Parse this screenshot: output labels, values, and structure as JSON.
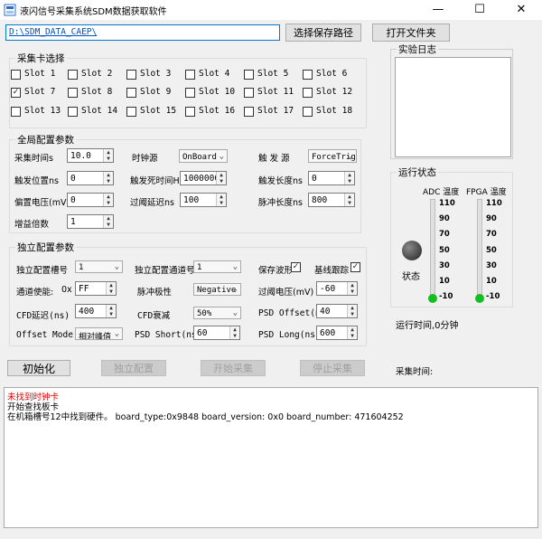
{
  "window": {
    "title": "液闪信号采集系统SDM数据获取软件",
    "minimize": "—",
    "maximize": "☐",
    "close": "✕"
  },
  "path": {
    "value": "D:\\SDM_DATA_CAEP\\",
    "save_button": "选择保存路径",
    "open_folder_button": "打开文件夹"
  },
  "slots": {
    "legend": "采集卡选择",
    "items": [
      {
        "label": "Slot 1",
        "checked": false
      },
      {
        "label": "Slot 2",
        "checked": false
      },
      {
        "label": "Slot 3",
        "checked": false
      },
      {
        "label": "Slot 4",
        "checked": false
      },
      {
        "label": "Slot 5",
        "checked": false
      },
      {
        "label": "Slot 6",
        "checked": false
      },
      {
        "label": "Slot 7",
        "checked": true
      },
      {
        "label": "Slot 8",
        "checked": false
      },
      {
        "label": "Slot 9",
        "checked": false
      },
      {
        "label": "Slot 10",
        "checked": false
      },
      {
        "label": "Slot 11",
        "checked": false
      },
      {
        "label": "Slot 12",
        "checked": false
      },
      {
        "label": "Slot 13",
        "checked": false
      },
      {
        "label": "Slot 14",
        "checked": false
      },
      {
        "label": "Slot 15",
        "checked": false
      },
      {
        "label": "Slot 16",
        "checked": false
      },
      {
        "label": "Slot 17",
        "checked": false
      },
      {
        "label": "Slot 18",
        "checked": false
      }
    ]
  },
  "global_config": {
    "legend": "全局配置参数",
    "acq_time_label": "采集时间s",
    "acq_time_value": "10.0",
    "clock_source_label": "时钟源",
    "clock_source_value": "OnBoard",
    "trigger_source_label": "触 发 源",
    "trigger_source_value": "ForceTrig",
    "trigger_pos_label": "触发位置ns",
    "trigger_pos_value": "0",
    "trigger_dead_label": "触发死时间Hz",
    "trigger_dead_value": "1000000",
    "trigger_len_label": "触发长度ns",
    "trigger_len_value": "0",
    "bias_label": "偏置电压(mV)",
    "bias_value": "0",
    "threshold_delay_label": "过阈延迟ns",
    "threshold_delay_value": "100",
    "pulse_len_label": "脉冲长度ns",
    "pulse_len_value": "800",
    "gain_label": "增益倍数",
    "gain_value": "1"
  },
  "independent_config": {
    "legend": "独立配置参数",
    "slot_label": "独立配置槽号",
    "slot_value": "1",
    "channel_label": "独立配置通道号",
    "channel_value": "1",
    "save_waveform_label": "保存波形",
    "save_waveform_checked": true,
    "baseline_label": "基线跟踪",
    "baseline_checked": true,
    "channel_enable_label": "通道使能:",
    "hex_prefix": "0x",
    "channel_enable_value": "FF",
    "polarity_label": "脉冲极性",
    "polarity_value": "Negative",
    "threshold_label": "过阈电压(mV)",
    "threshold_value": "-60",
    "cfd_delay_label": "CFD延迟(ns)",
    "cfd_delay_value": "400",
    "cfd_atten_label": "CFD衰减",
    "cfd_atten_value": "50%",
    "psd_offset_label": "PSD Offset(ns)",
    "psd_offset_value": "40",
    "offset_mode_label": "Offset Mode",
    "offset_mode_value": "相对峰值",
    "psd_short_label": "PSD Short(ns)",
    "psd_short_value": "60",
    "psd_long_label": "PSD Long(ns)",
    "psd_long_value": "600"
  },
  "buttons": {
    "init": "初始化",
    "independent": "独立配置",
    "start": "开始采集",
    "stop": "停止采集"
  },
  "acq_time_label": "采集时间:",
  "experiment_log": {
    "legend": "实验日志"
  },
  "status": {
    "legend": "运行状态",
    "adc_label": "ADC 温度",
    "fpga_label": "FPGA 温度",
    "state_label": "状态",
    "ticks": [
      "110",
      "90",
      "70",
      "50",
      "30",
      "10",
      "-10"
    ],
    "adc_temp": -10,
    "fpga_temp": -10,
    "runtime": "运行时间,0分钟",
    "indicator_color": "#404040",
    "bulb_color": "#10c020"
  },
  "log": {
    "lines": [
      {
        "text": "未找到时钟卡",
        "color": "#e00000"
      },
      {
        "text": "开始查找板卡",
        "color": "#000000"
      },
      {
        "text": "在机箱槽号12中找到硬件。 board_type:0x9848      board_version: 0x0       board_number: 471604252",
        "color": "#000000"
      }
    ]
  }
}
